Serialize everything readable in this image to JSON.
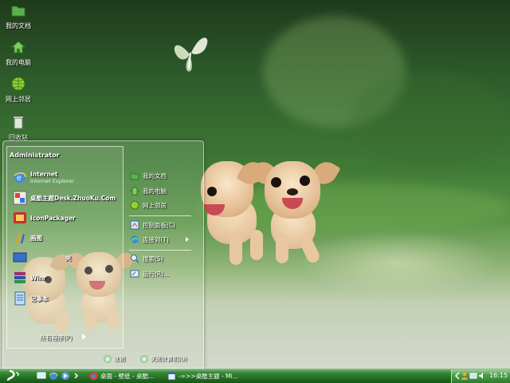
{
  "desktop": {
    "icons": [
      {
        "label": "我的文档",
        "icon": "folder-icon"
      },
      {
        "label": "我的电脑",
        "icon": "home-icon"
      },
      {
        "label": "网上邻居",
        "icon": "globe-icon"
      },
      {
        "label": "回收站",
        "icon": "recycle-bin-icon"
      }
    ]
  },
  "start_menu": {
    "user": "Administrator",
    "pinned": [
      {
        "title": "Internet",
        "subtitle": "Internet Explorer",
        "icon": "ie-icon"
      },
      {
        "title": "桌酷主题Desk.ZhuoKu.Com",
        "icon": "theme-icon"
      },
      {
        "title": "IconPackager",
        "icon": "iconpackager-icon"
      },
      {
        "title": "画图",
        "icon": "paint-icon"
      },
      {
        "title": "",
        "icon": "app-icon"
      },
      {
        "title": "Winr",
        "icon": "winrar-icon"
      },
      {
        "title": "记事本",
        "icon": "notepad-icon"
      }
    ],
    "partial_text": "夹",
    "all_programs": "所有程序(P)",
    "right": [
      {
        "label": "我的文档",
        "icon": "folder-icon"
      },
      {
        "label": "我的电脑",
        "icon": "home-icon"
      },
      {
        "label": "网上邻居",
        "icon": "globe-icon"
      },
      {
        "label": "控制面板(C)",
        "icon": "control-panel-icon"
      },
      {
        "label": "连接到(T)",
        "icon": "connect-icon"
      },
      {
        "label": "搜索(S)",
        "icon": "search-icon"
      },
      {
        "label": "运行(R)...",
        "icon": "run-icon"
      }
    ],
    "logoff": "注销",
    "shutdown": "关闭计算机(U)"
  },
  "taskbar": {
    "tasks": [
      {
        "label": "桌面 - 壁纸 - 桌酷...",
        "icon": "browser-icon"
      },
      {
        "label": "-=>>桌酷主题 - Mi...",
        "icon": "window-icon"
      }
    ],
    "clock": "16:15",
    "accent": "#1f6b1f"
  }
}
